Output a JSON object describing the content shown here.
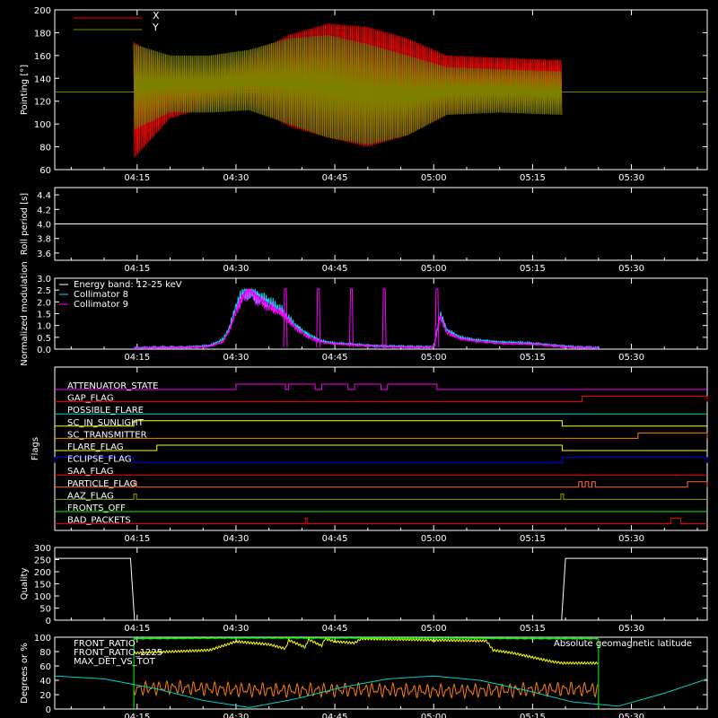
{
  "colors": {
    "background": "#000000",
    "axes": "#ffffff",
    "x_red": "#ff0000",
    "y_olive": "#808000",
    "white": "#ffffff",
    "cyan": "#00e0ff",
    "magenta": "#ff00ff",
    "yellow": "#ffff00",
    "green": "#00ff00",
    "orange": "#ff7f00",
    "blue": "#0000ff",
    "teal": "#00d0d0",
    "salmon": "#ff6a3a",
    "olive2": "#9a9a00"
  },
  "time_axis": {
    "labels": [
      "04:15",
      "04:30",
      "04:45",
      "05:00",
      "05:15",
      "05:30"
    ],
    "tick_minutes": [
      255,
      270,
      285,
      300,
      315,
      330
    ],
    "start_minute": 242.5,
    "end_minute": 341.5,
    "data_start_minute": 254.5,
    "data_end_minute": 319.5
  },
  "chart_data": [
    {
      "type": "line",
      "panel": "pointing",
      "ylabel": "Pointing [°]",
      "ylim": [
        60,
        200
      ],
      "yticks": [
        60,
        80,
        100,
        120,
        140,
        160,
        180,
        200
      ],
      "series": [
        {
          "name": "X",
          "color": "#ff0000",
          "envelope_upper": [
            172,
            150,
            145,
            160,
            178,
            188,
            185,
            175,
            160,
            158,
            156
          ],
          "envelope_lower": [
            70,
            105,
            115,
            118,
            98,
            88,
            80,
            90,
            108,
            114,
            118
          ],
          "envelope_x_minutes": [
            254.5,
            260,
            266,
            272,
            278,
            284,
            290,
            296,
            302,
            310,
            319.5
          ]
        },
        {
          "name": "Y",
          "color": "#808000",
          "envelope_upper": [
            170,
            160,
            160,
            165,
            175,
            178,
            170,
            160,
            150,
            148,
            146
          ],
          "envelope_lower": [
            95,
            110,
            110,
            112,
            100,
            88,
            82,
            90,
            108,
            110,
            108
          ],
          "envelope_x_minutes": [
            254.5,
            260,
            266,
            272,
            278,
            284,
            290,
            296,
            302,
            310,
            319.5
          ]
        }
      ],
      "flat_value": 128
    },
    {
      "type": "line",
      "panel": "roll",
      "ylabel": "Roll period [s]",
      "ylim": [
        3.5,
        4.5
      ],
      "yticks": [
        3.6,
        3.8,
        4.0,
        4.2,
        4.4
      ],
      "yticklabels": [
        "3.6",
        "3.8",
        "4.0",
        "4.2",
        "4.4"
      ],
      "series": [
        {
          "name": "",
          "color": "#ffffff",
          "value": 4.0
        }
      ]
    },
    {
      "type": "line",
      "panel": "modulation",
      "ylabel": "Normalized modulation",
      "ylim": [
        0,
        3.0
      ],
      "yticks": [
        0,
        0.5,
        1.0,
        1.5,
        2.0,
        2.5,
        3.0
      ],
      "yticklabels": [
        "0.0",
        "0.5",
        "1.0",
        "1.5",
        "2.0",
        "2.5",
        "3.0"
      ],
      "legend": [
        {
          "label": "Energy band: 12-25 keV",
          "color": "#ffffff"
        },
        {
          "label": "Collimator 8",
          "color": "#00e0ff"
        },
        {
          "label": "Collimator 9",
          "color": "#ff00ff"
        }
      ],
      "series": [
        {
          "name": "Collimator 8",
          "color": "#00e0ff",
          "x": [
            254.5,
            262,
            266,
            268,
            269,
            270,
            271,
            272,
            273,
            275,
            277,
            279,
            281,
            283,
            285,
            288,
            291,
            294,
            296,
            300,
            301,
            302,
            304,
            306,
            308,
            310,
            313,
            316,
            319,
            322,
            325
          ],
          "y": [
            0.05,
            0.08,
            0.15,
            0.4,
            0.9,
            1.8,
            2.4,
            2.5,
            2.3,
            2.0,
            1.6,
            1.0,
            0.6,
            0.35,
            0.25,
            0.2,
            0.15,
            0.12,
            0.1,
            0.1,
            1.5,
            0.8,
            0.5,
            0.4,
            0.35,
            0.3,
            0.28,
            0.22,
            0.15,
            0.08,
            0.05
          ]
        },
        {
          "name": "Collimator 9",
          "color": "#ff00ff",
          "x": [
            254.5,
            262,
            266,
            268,
            269,
            270,
            271,
            272,
            273,
            275,
            277,
            279,
            281,
            283,
            285,
            288,
            291,
            294,
            296,
            300,
            301,
            302,
            304,
            306,
            308,
            310,
            313,
            316,
            319,
            322,
            325
          ],
          "y": [
            0.04,
            0.07,
            0.12,
            0.3,
            0.8,
            1.6,
            2.2,
            2.5,
            2.2,
            1.8,
            1.5,
            0.9,
            0.5,
            0.3,
            0.22,
            0.18,
            0.12,
            0.1,
            0.08,
            0.08,
            1.4,
            0.7,
            0.45,
            0.35,
            0.3,
            0.25,
            0.22,
            0.2,
            0.12,
            0.06,
            0.04
          ]
        }
      ],
      "spikes_minutes": [
        277.5,
        282.5,
        287.5,
        292.5,
        300.5
      ]
    },
    {
      "type": "line",
      "panel": "flags",
      "ylabel": "Flags",
      "flags": [
        {
          "label": "ATTENUATOR_STATE",
          "color": "#ff00ff",
          "high_intervals": [
            [
              270,
              277.5
            ],
            [
              278,
              282
            ],
            [
              283,
              287
            ],
            [
              288,
              292
            ],
            [
              293,
              300.5
            ]
          ]
        },
        {
          "label": "GAP_FLAG",
          "color": "#ff0000",
          "high_intervals": [
            [
              322.5,
              341.5
            ]
          ]
        },
        {
          "label": "POSSIBLE_FLARE",
          "color": "#00d0d0",
          "high_intervals": []
        },
        {
          "label": "SC_IN_SUNLIGHT",
          "color": "#ffff00",
          "high_intervals": [
            [
              254.5,
              319.5
            ]
          ]
        },
        {
          "label": "SC_TRANSMITTER",
          "color": "#ff7f00",
          "high_intervals": [
            [
              331,
              341.5
            ]
          ]
        },
        {
          "label": "FLARE_FLAG",
          "color": "#ffff00",
          "high_intervals": [
            [
              258,
              319.5
            ]
          ]
        },
        {
          "label": "ECLIPSE_FLAG",
          "color": "#0000ff",
          "high_intervals": [
            [
              242.5,
              254.5
            ],
            [
              319.5,
              341.5
            ]
          ]
        },
        {
          "label": "SAA_FLAG",
          "color": "#ff0000",
          "high_intervals": []
        },
        {
          "label": "PARTICLE_FLAG",
          "color": "#ff6a3a",
          "high_intervals": [
            [
              254.5,
              254.9
            ],
            [
              322,
              322.5
            ],
            [
              323,
              323.5
            ],
            [
              324,
              324.5
            ],
            [
              338.5,
              341.5
            ]
          ]
        },
        {
          "label": "AAZ_FLAG",
          "color": "#9a9a00",
          "high_intervals": [
            [
              254.5,
              254.9
            ],
            [
              319.3,
              319.7
            ]
          ]
        },
        {
          "label": "FRONTS_OFF",
          "color": "#00ff00",
          "high_intervals": []
        },
        {
          "label": "BAD_PACKETS",
          "color": "#ff0000",
          "high_intervals": [
            [
              280.5,
              280.8
            ],
            [
              336,
              337.5
            ]
          ]
        }
      ]
    },
    {
      "type": "line",
      "panel": "quality",
      "ylabel": "Quality",
      "ylim": [
        0,
        300
      ],
      "yticks": [
        0,
        50,
        100,
        150,
        200,
        250,
        300
      ],
      "series": [
        {
          "name": "",
          "color": "#ffffff",
          "x": [
            242.5,
            254.0,
            254.6,
            319.4,
            320.0,
            341.5
          ],
          "y": [
            255,
            255,
            0,
            0,
            255,
            255
          ]
        }
      ]
    },
    {
      "type": "line",
      "panel": "ratios",
      "ylabel": "Degrees or %",
      "ylim": [
        0,
        100
      ],
      "yticks": [
        0,
        20,
        40,
        60,
        80,
        100
      ],
      "legend": [
        {
          "label": "FRONT_RATIO",
          "color": "#ffff00"
        },
        {
          "label": "FRONT_RATIO_1225",
          "color": "#00ff00"
        },
        {
          "label": "MAX_DET_VS_TOT",
          "color": "#ff7f00"
        },
        {
          "label": "Absolute geomagnetic latitude",
          "color": "#00d0d0"
        }
      ],
      "series": [
        {
          "name": "FRONT_RATIO",
          "color": "#ffff00",
          "x": [
            254.5,
            260,
            266,
            268,
            270,
            275,
            277.5,
            278,
            280.5,
            281,
            283,
            283.5,
            285,
            288,
            289,
            300,
            308,
            309,
            312,
            316,
            318,
            319.5,
            325
          ],
          "y": [
            78,
            80,
            82,
            88,
            94,
            90,
            84,
            96,
            86,
            97,
            88,
            98,
            94,
            92,
            98,
            96,
            95,
            82,
            78,
            70,
            66,
            64,
            64
          ]
        },
        {
          "name": "FRONT_RATIO_1225",
          "color": "#00ff00",
          "x": [
            254.5,
            270,
            285,
            300,
            315,
            325
          ],
          "y": [
            98,
            99,
            99,
            99,
            98,
            98
          ]
        },
        {
          "name": "MAX_DET_VS_TOT",
          "color": "#ff7f00",
          "x": [
            254.5,
            260,
            270,
            280,
            290,
            300,
            310,
            320,
            325
          ],
          "y": [
            28,
            30,
            27,
            26,
            27,
            25,
            26,
            28,
            27
          ]
        },
        {
          "name": "Absolute geomagnetic latitude",
          "color": "#00d0d0",
          "x": [
            242.5,
            250,
            258,
            265,
            272,
            279,
            286,
            293,
            300,
            307,
            314,
            321,
            328,
            335,
            341.5
          ],
          "y": [
            46,
            42,
            28,
            12,
            2,
            14,
            30,
            42,
            46,
            40,
            26,
            10,
            4,
            22,
            42
          ]
        }
      ]
    }
  ]
}
